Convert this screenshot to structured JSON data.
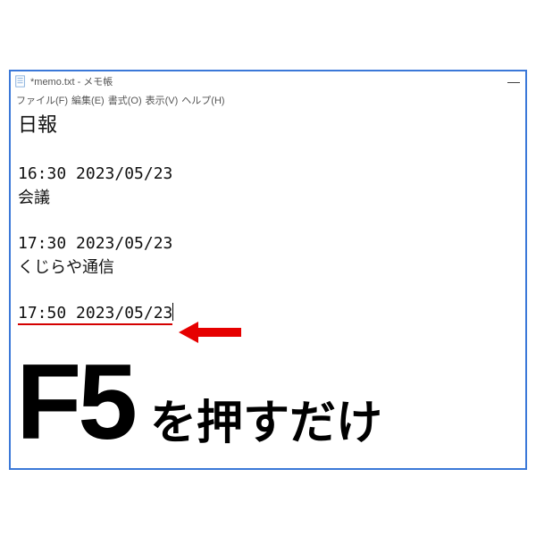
{
  "window": {
    "title": "*memo.txt - メモ帳"
  },
  "menu": {
    "file": "ファイル(F)",
    "edit": "編集(E)",
    "format": "書式(O)",
    "view": "表示(V)",
    "help": "ヘルプ(H)"
  },
  "content": {
    "heading": "日報",
    "entry1_time": "16:30 2023/05/23",
    "entry1_text": "会議",
    "entry2_time": "17:30 2023/05/23",
    "entry2_text": "くじらや通信",
    "entry3_time": "17:50 2023/05/23"
  },
  "annotation": {
    "main": "F5",
    "rest": "を押すだけ",
    "arrow_color": "#e60000"
  }
}
